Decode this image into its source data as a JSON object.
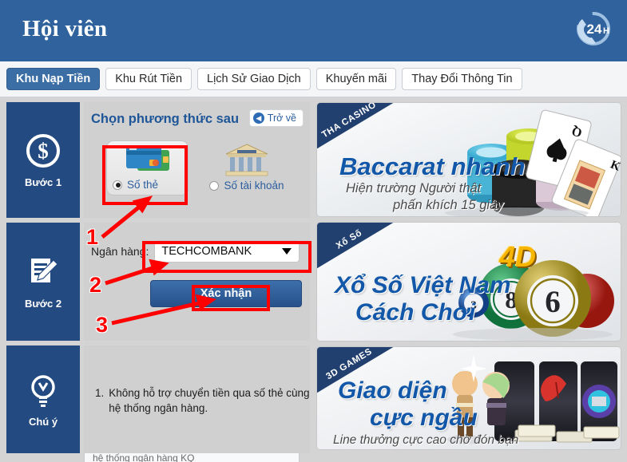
{
  "header": {
    "title": "Hội viên",
    "logo_alt": "24H",
    "logo_text": "24",
    "logo_sub": "H",
    "bg_color": "#30629d"
  },
  "tabs": [
    {
      "label": "Khu Nạp Tiền",
      "active": true
    },
    {
      "label": "Khu Rút Tiền",
      "active": false
    },
    {
      "label": "Lịch Sử Giao Dịch",
      "active": false
    },
    {
      "label": "Khuyến mãi",
      "active": false
    },
    {
      "label": "Thay Đổi Thông Tin",
      "active": false
    }
  ],
  "steps": [
    {
      "label": "Bước 1",
      "icon": "dollar-circle-icon"
    },
    {
      "label": "Bước 2",
      "icon": "form-pencil-icon"
    },
    {
      "label": "Chú ý",
      "icon": "lightbulb-icon"
    }
  ],
  "step1": {
    "title": "Chọn phương thức sau",
    "back_label": "Trở về",
    "methods": [
      {
        "label": "Số thẻ",
        "selected": true,
        "icon": "credit-cards-icon"
      },
      {
        "label": "Số tài khoản",
        "selected": false,
        "icon": "bank-building-icon"
      }
    ]
  },
  "step2": {
    "bank_label": "Ngân hàng:",
    "bank_value": "TECHCOMBANK",
    "confirm_label": "Xác nhận"
  },
  "step3": {
    "note_number": "1.",
    "note_text": "Không hỗ trợ chuyển tiền qua số thẻ cùng hệ thống ngân hàng.",
    "cut_text": "hệ thống ngân hàng KQ"
  },
  "annotations": {
    "accent_color": "#fe0000",
    "markers": [
      {
        "number": "1",
        "target": "payment-method-card"
      },
      {
        "number": "2",
        "target": "bank-select"
      },
      {
        "number": "3",
        "target": "confirm-button"
      }
    ]
  },
  "banners": [
    {
      "ribbon": "THA CASINO",
      "headline": "Baccarat nhanh",
      "sub1": "Hiện trường Người thật",
      "sub2": "phấn khích 15 giây"
    },
    {
      "ribbon": "Xổ Số",
      "headline1": "Xổ Số Việt Nam",
      "headline2": "Cách Chơi",
      "badge": "4D",
      "ball_numbers": [
        "3",
        "8",
        "6"
      ]
    },
    {
      "ribbon": "3D GAMES",
      "headline1": "Giao diện",
      "headline2": "cực ngầu",
      "sub": "Line thưởng cực cao chờ đón bạn"
    }
  ]
}
